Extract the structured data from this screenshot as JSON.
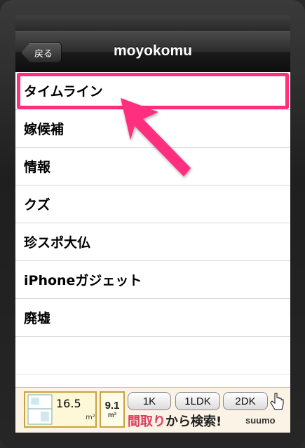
{
  "nav": {
    "back_label": "戻る",
    "title": "moyokomu"
  },
  "list": {
    "items": [
      {
        "label": "タイムライン"
      },
      {
        "label": "嫁候補"
      },
      {
        "label": "情報"
      },
      {
        "label": "クズ"
      },
      {
        "label": "珍スポ大仏"
      },
      {
        "label": "iPhoneガジェット"
      },
      {
        "label": "廃墟"
      }
    ]
  },
  "annotation": {
    "highlight_color": "#ff2e7e"
  },
  "ad": {
    "size_a": "16.5",
    "unit_a": "m²",
    "size_b": "9.1",
    "unit_b": "m²",
    "pill_1": "1K",
    "pill_2": "1LDK",
    "pill_3": "2DK",
    "tagline_red": "間取り",
    "tagline_rest": "から検索!",
    "brand": "suumo"
  }
}
